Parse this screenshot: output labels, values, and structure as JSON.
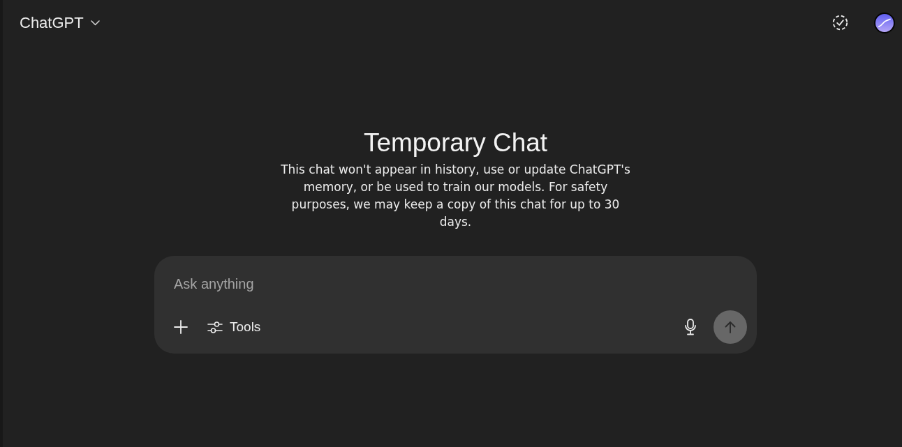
{
  "header": {
    "model_selector": "ChatGPT"
  },
  "intro": {
    "title": "Temporary Chat",
    "description": "This chat won't appear in history, use or update ChatGPT's memory, or be used to train our models. For safety purposes, we may keep a copy of this chat for up to 30 days."
  },
  "composer": {
    "placeholder": "Ask anything",
    "tools_label": "Tools",
    "send_disabled": true
  }
}
